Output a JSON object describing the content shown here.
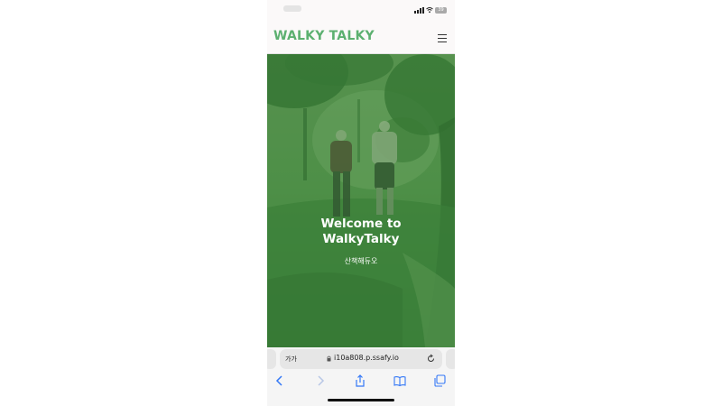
{
  "app": {
    "brand": "WALKY TALKY",
    "brand_color": "#5cb070"
  },
  "status_bar": {
    "battery": "39",
    "icons": [
      "signal-icon",
      "wifi-icon",
      "battery-icon"
    ]
  },
  "hero": {
    "title_line1": "Welcome to",
    "title_line2": "WalkyTalky",
    "subtitle": "산책해듀오",
    "overlay_color": "#3a8238"
  },
  "browser": {
    "text_size_label": "가가",
    "url": "i10a808.p.ssafy.io",
    "toolbar": [
      "back-icon",
      "forward-icon",
      "share-icon",
      "bookmarks-icon",
      "tabs-icon"
    ]
  }
}
